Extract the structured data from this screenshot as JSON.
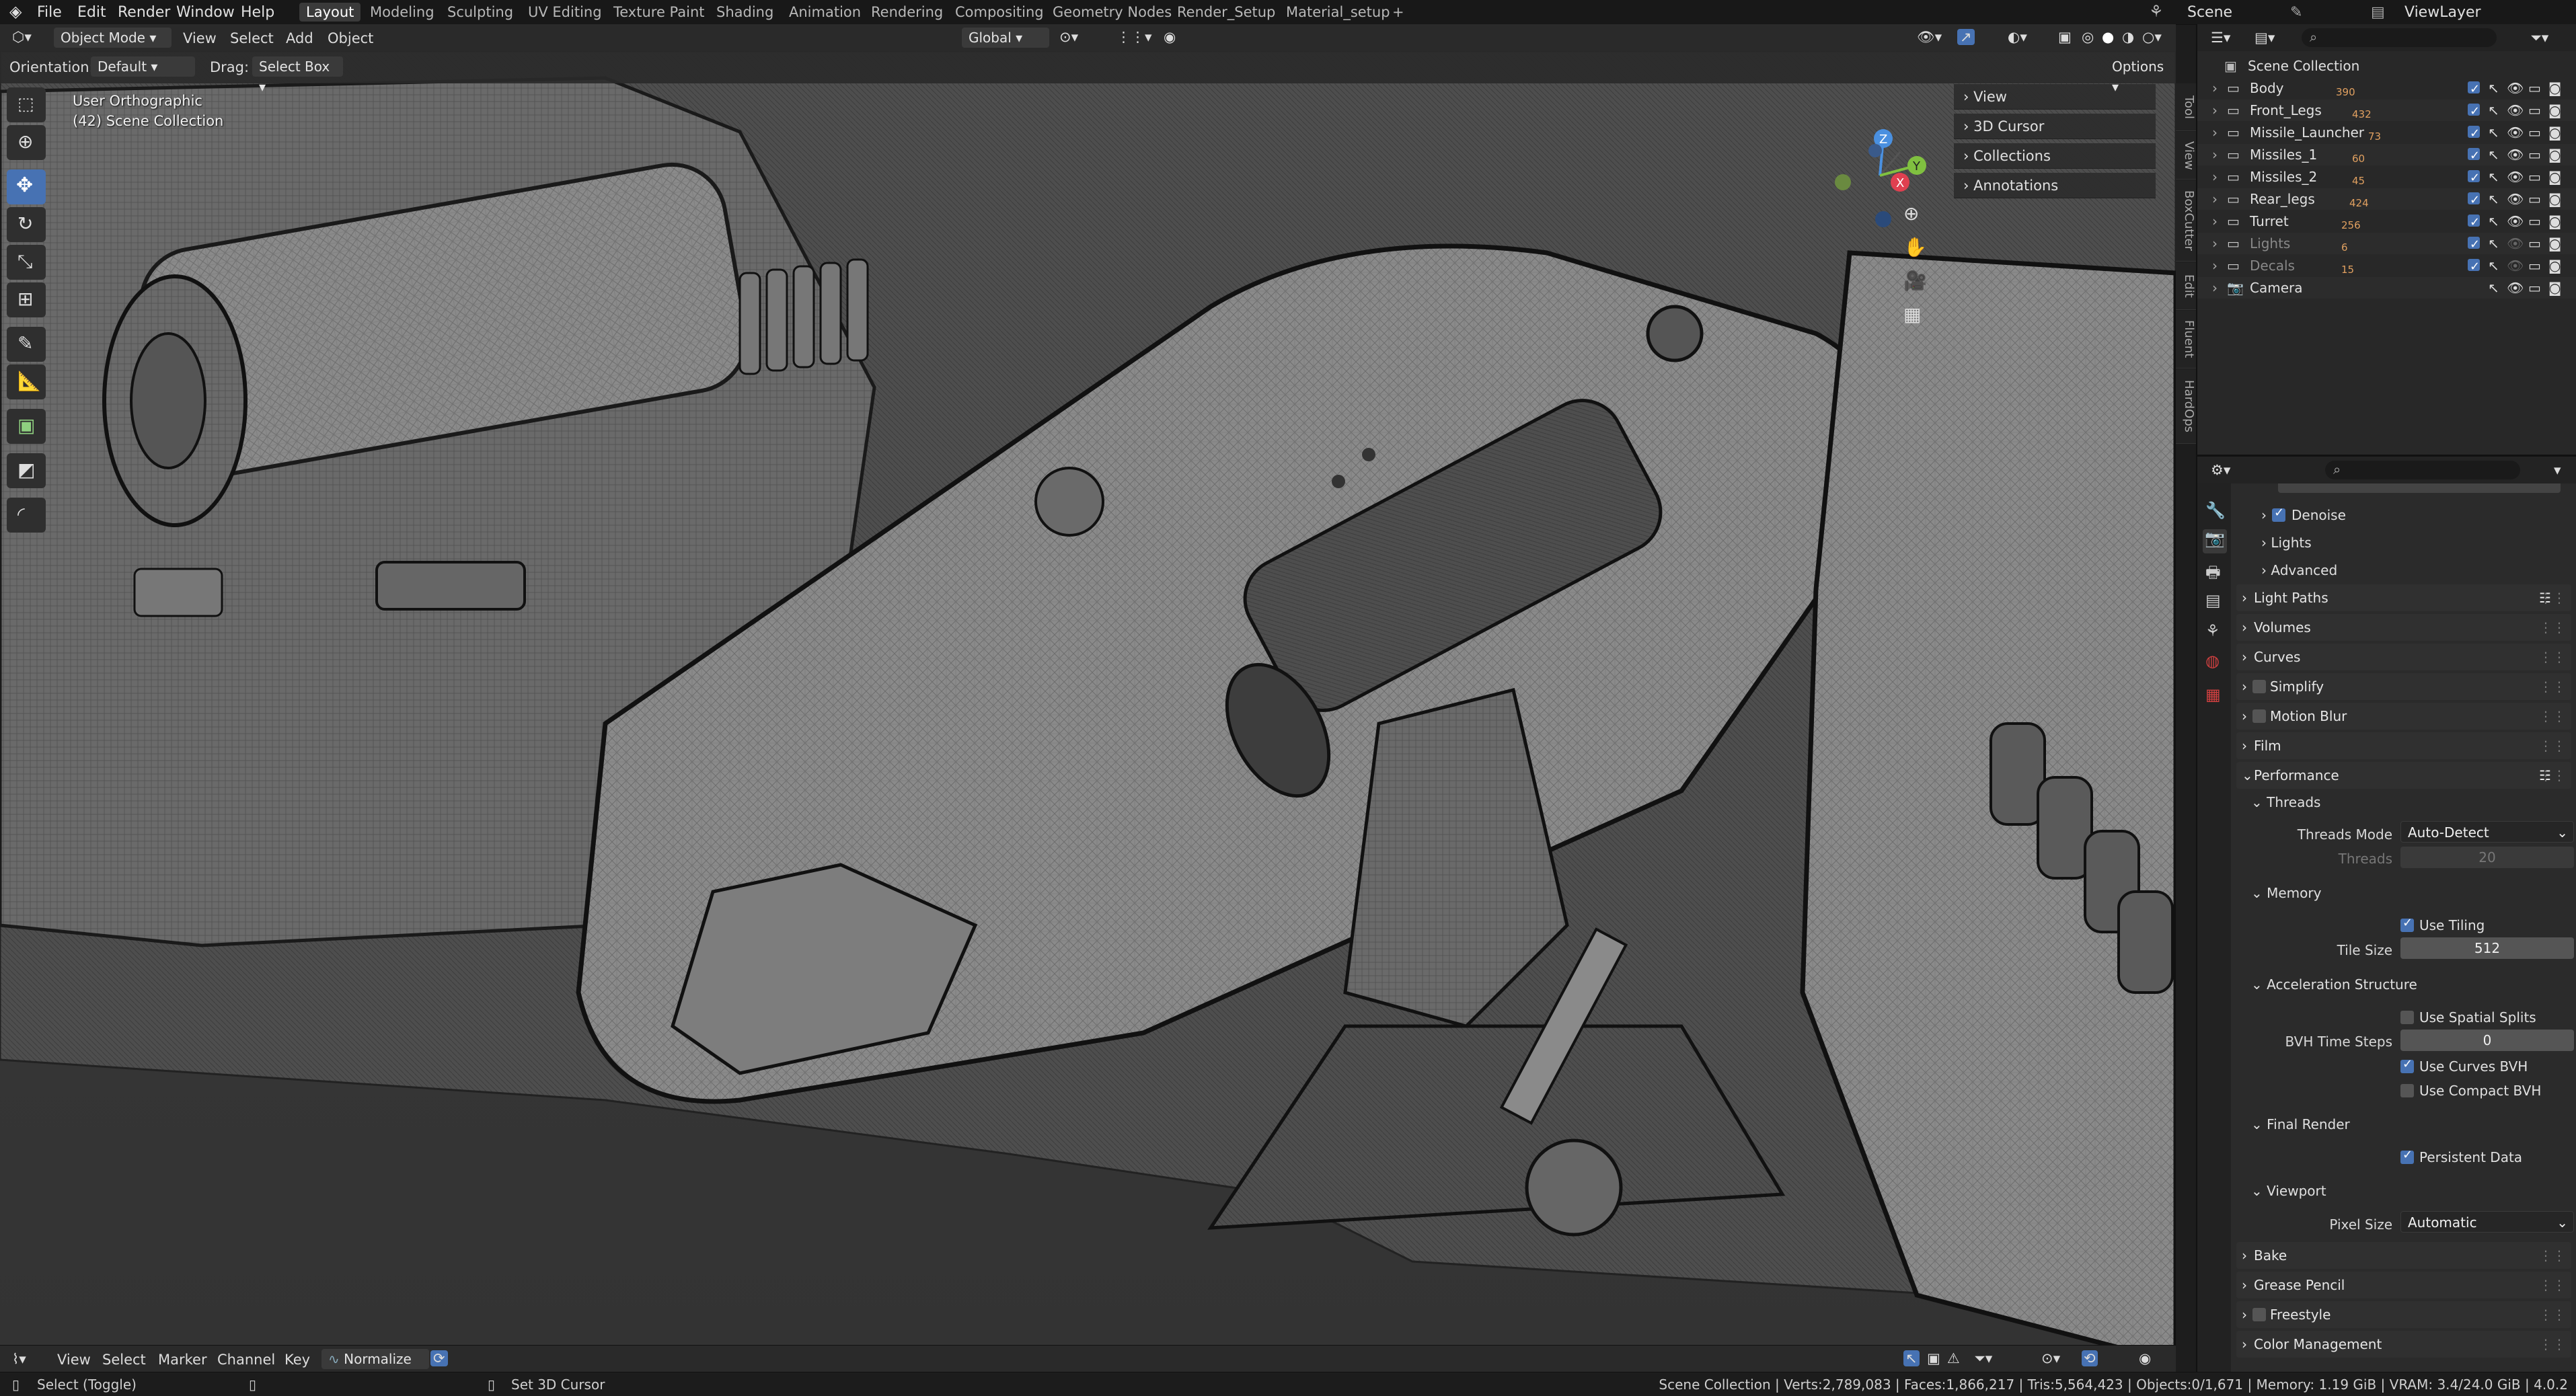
{
  "topbar": {
    "menus": [
      "File",
      "Edit",
      "Render",
      "Window",
      "Help"
    ],
    "workspaces": [
      "Layout",
      "Modeling",
      "Sculpting",
      "UV Editing",
      "Texture Paint",
      "Shading",
      "Animation",
      "Rendering",
      "Compositing",
      "Geometry Nodes",
      "Render_Setup",
      "Material_setup"
    ],
    "active_workspace": "Layout",
    "add_tab": "+",
    "scene": "Scene",
    "view_layer": "ViewLayer"
  },
  "viewport_header": {
    "mode": "Object Mode",
    "menus": [
      "View",
      "Select",
      "Add",
      "Object"
    ],
    "transform": "Global",
    "orientation_label": "Orientation:",
    "orientation_value": "Default",
    "drag_label": "Drag:",
    "drag_value": "Select Box",
    "options": "Options"
  },
  "viewport": {
    "view_name": "User Orthographic",
    "collection_info": "(42) Scene Collection",
    "gizmo": {
      "x": "X",
      "y": "Y",
      "z": "Z"
    }
  },
  "npanel": {
    "items": [
      "View",
      "3D Cursor",
      "Collections",
      "Annotations"
    ]
  },
  "side_tabs": [
    "Tool",
    "View",
    "BoxCutter",
    "Edit",
    "Fluent",
    "HardOps"
  ],
  "outliner": {
    "root": "Scene Collection",
    "items": [
      {
        "name": "Body",
        "count": "390"
      },
      {
        "name": "Front_Legs",
        "count": "432"
      },
      {
        "name": "Missile_Launcher",
        "count": "73"
      },
      {
        "name": "Missiles_1",
        "count": "60"
      },
      {
        "name": "Missiles_2",
        "count": "45"
      },
      {
        "name": "Rear_legs",
        "count": "424"
      },
      {
        "name": "Turret",
        "count": "256"
      },
      {
        "name": "Lights",
        "count": "6"
      },
      {
        "name": "Decals",
        "count": "15"
      },
      {
        "name": "Camera",
        "count": ""
      }
    ]
  },
  "properties": {
    "subsections_top": [
      {
        "label": "Denoise",
        "checked": true
      },
      {
        "label": "Lights"
      },
      {
        "label": "Advanced"
      }
    ],
    "sections_closed": [
      "Light Paths",
      "Volumes",
      "Curves",
      "Simplify",
      "Motion Blur",
      "Film"
    ],
    "performance": {
      "title": "Performance",
      "threads_title": "Threads",
      "threads_mode_label": "Threads Mode",
      "threads_mode_value": "Auto-Detect",
      "threads_label": "Threads",
      "threads_value": "20",
      "memory_title": "Memory",
      "use_tiling": "Use Tiling",
      "tile_size_label": "Tile Size",
      "tile_size_value": "512",
      "accel_title": "Acceleration Structure",
      "use_spatial_splits": "Use Spatial Splits",
      "bvh_label": "BVH Time Steps",
      "bvh_value": "0",
      "use_curves_bvh": "Use Curves BVH",
      "use_compact_bvh": "Use Compact BVH",
      "final_render_title": "Final Render",
      "persistent_data": "Persistent Data",
      "viewport_title": "Viewport",
      "pixel_size_label": "Pixel Size",
      "pixel_size_value": "Automatic"
    },
    "sections_bottom": [
      "Bake",
      "Grease Pencil",
      "Freestyle",
      "Color Management"
    ]
  },
  "timeline_header": {
    "menus": [
      "View",
      "Select",
      "Marker",
      "Channel",
      "Key"
    ],
    "normalize": "Normalize"
  },
  "statusbar": {
    "select": "Select (Toggle)",
    "cursor": "Set 3D Cursor",
    "stats": "Scene Collection | Verts:2,789,083 | Faces:1,866,217 | Tris:5,564,423 | Objects:0/1,671 | Memory: 1.19 GiB | VRAM: 3.4/24.0 GiB | 4.0.2"
  },
  "colors": {
    "accent": "#4772b3",
    "axis_x": "#e04050",
    "axis_y": "#80c040",
    "axis_z": "#4a90e0"
  }
}
